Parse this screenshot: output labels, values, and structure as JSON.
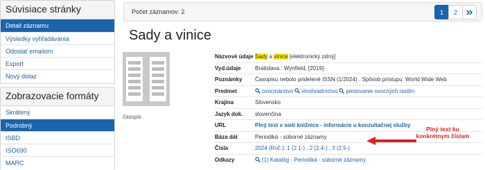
{
  "sidebar": {
    "related_title": "Súvisiace stránky",
    "related_items": [
      {
        "label": "Detail záznamu",
        "active": true
      },
      {
        "label": "Výsledky vyhľadávania",
        "active": false
      },
      {
        "label": "Odoslať emailom",
        "active": false
      },
      {
        "label": "Export",
        "active": false
      },
      {
        "label": "Nový dotaz",
        "active": false
      }
    ],
    "formats_title": "Zobrazovacie formáty",
    "format_items": [
      {
        "label": "Skrátený",
        "active": false
      },
      {
        "label": "Podrobný",
        "active": true
      },
      {
        "label": "ISBD",
        "active": false
      },
      {
        "label": "ISO690",
        "active": false
      },
      {
        "label": "MARC",
        "active": false
      }
    ]
  },
  "topbar": {
    "count_label": "Počet záznamov: 2",
    "pages": [
      "1",
      "2"
    ],
    "current_page": "1",
    "next_label": "»"
  },
  "record": {
    "title": "Sady a vinice",
    "type_caption": "časopis",
    "title_label": "Názvové údaje",
    "title_hl1": "Sady",
    "title_mid": " a ",
    "title_hl2": "vinice",
    "title_rest": " [elektronický zdroj]",
    "pub_label": "Vyd.údaje",
    "pub_value": "Bratislava : Wynfield, [2019]-",
    "notes_label": "Poznámky",
    "notes_value": "Časopisu nebolo pridelené ISSN (1/2024) . Spôsob prístupu: World Wide Web",
    "subject_label": "Predmet",
    "subjects": [
      "ovocinárstvo",
      "vinohradníctvo",
      "pestovanie ovocných rastlín"
    ],
    "country_label": "Krajina",
    "country_value": "Slovensko",
    "lang_label": "Jazyk dok.",
    "lang_value": "slovenčina",
    "url_label": "URL",
    "url_value": "Plný text v sieti knižnice - informácie u konzultačnej služby",
    "db_label": "Báza dát",
    "db_value": "Periodiká - súborné záznamy",
    "issues_label": "Čísla",
    "issues_value": "2024 (Roč.):  1 (2.1-) ,  2 (2.4-) ,  3 (2.5-)",
    "refs_label": "Odkazy",
    "refs_value": "(1) Katalóg - Periodiká - súborné záznamy"
  },
  "annotation": {
    "line1": "Plný text ku",
    "line2": "konkrétnym číslam",
    "color": "#e0201a"
  }
}
